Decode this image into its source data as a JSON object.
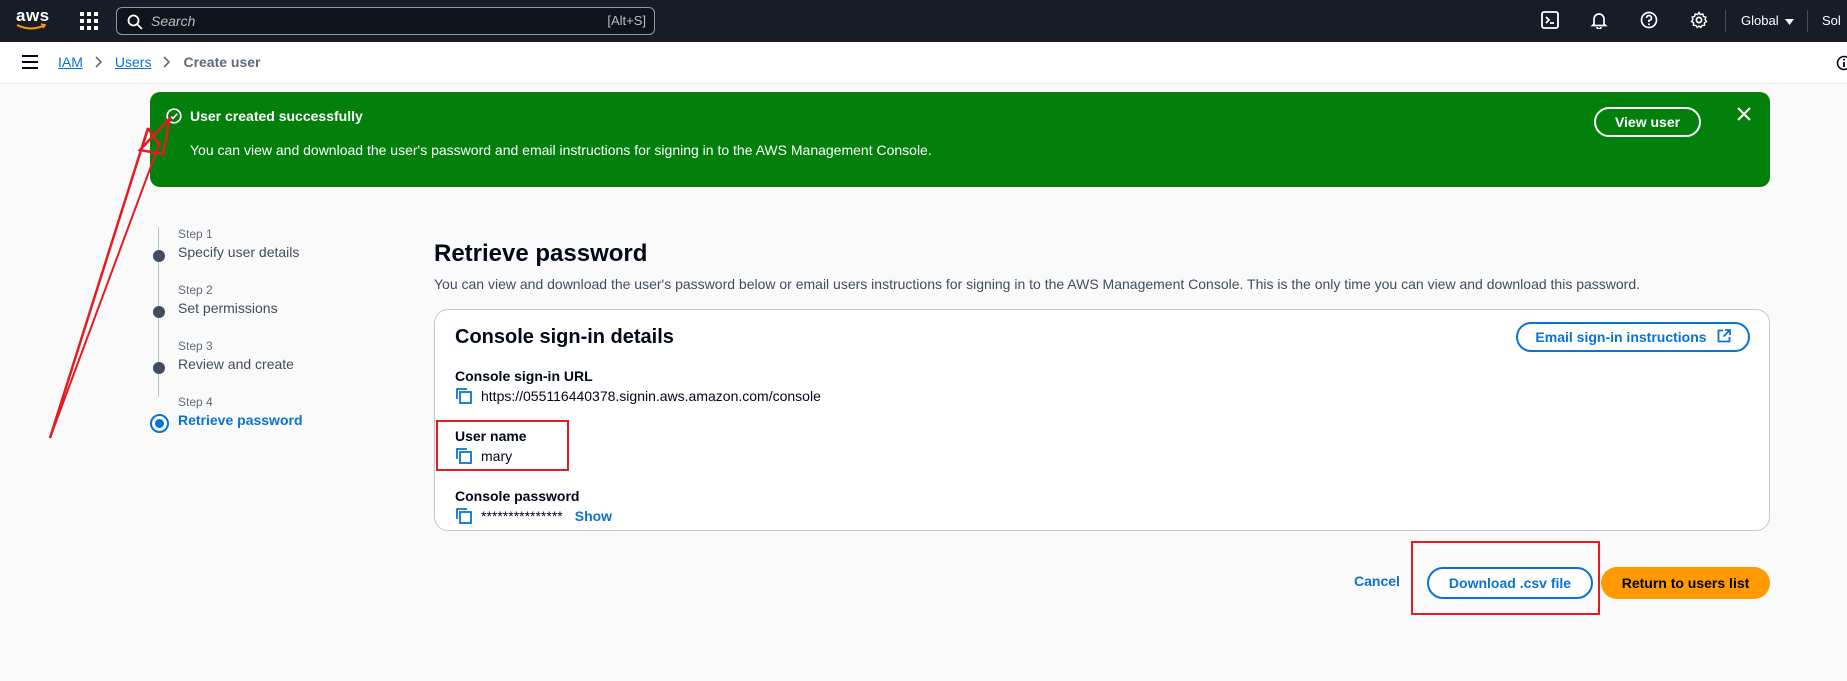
{
  "topbar": {
    "logo_text": "aws",
    "search_placeholder": "Search",
    "search_shortcut": "[Alt+S]",
    "region": "Global",
    "account": "Sol",
    "icons": [
      "apps-grid-icon",
      "cloudshell-icon",
      "bell-icon",
      "help-icon",
      "gear-icon"
    ]
  },
  "breadcrumb": {
    "items": [
      "IAM",
      "Users"
    ],
    "current": "Create user"
  },
  "flash": {
    "title": "User created successfully",
    "message": "You can view and download the user's password and email instructions for signing in to the AWS Management Console.",
    "view_button": "View user",
    "color": "#037f0c"
  },
  "steps": [
    {
      "number": "Step 1",
      "label": "Specify user details"
    },
    {
      "number": "Step 2",
      "label": "Set permissions"
    },
    {
      "number": "Step 3",
      "label": "Review and create"
    },
    {
      "number": "Step 4",
      "label": "Retrieve password",
      "active": true
    }
  ],
  "page": {
    "title": "Retrieve password",
    "description": "You can view and download the user's password below or email users instructions for signing in to the AWS Management Console. This is the only time you can view and download this password."
  },
  "details": {
    "title": "Console sign-in details",
    "email_button": "Email sign-in instructions",
    "url_label": "Console sign-in URL",
    "url_value": "https://055116440378.signin.aws.amazon.com/console",
    "username_label": "User name",
    "username_value": "mary",
    "password_label": "Console password",
    "password_value": "***************",
    "show_label": "Show"
  },
  "actions": {
    "cancel": "Cancel",
    "download": "Download .csv file",
    "return": "Return to users list"
  },
  "colors": {
    "accent": "#0972d3",
    "primary_button": "#ff9900",
    "annotation": "#e31b23"
  }
}
